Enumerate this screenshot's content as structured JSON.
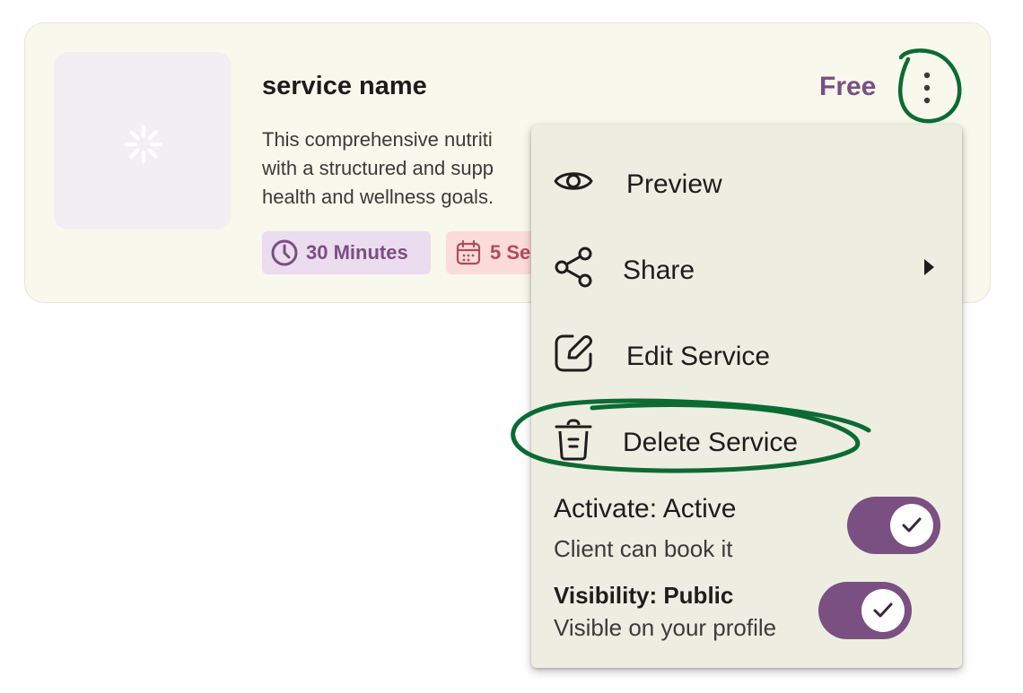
{
  "service": {
    "name": "service name",
    "price": "Free",
    "description_lines": [
      "This comprehensive nutriti",
      "with a structured and supp",
      "health and wellness goals."
    ],
    "duration": "30 Minutes",
    "sessions": "5 Se",
    "thumbnail_icon": "loader-icon",
    "more_icon": "more-vertical-icon"
  },
  "menu": {
    "preview": {
      "label": "Preview",
      "icon": "eye-icon"
    },
    "share": {
      "label": "Share",
      "icon": "share-icon"
    },
    "edit": {
      "label": "Edit Service",
      "icon": "edit-icon"
    },
    "delete": {
      "label": "Delete Service",
      "icon": "trash-icon"
    },
    "activate": {
      "title": "Activate: Active",
      "subtitle": "Client can book it",
      "on": true
    },
    "visibility": {
      "title": "Visibility: Public",
      "subtitle": "Visible on your profile",
      "on": true
    }
  },
  "colors": {
    "accent": "#7a4f82",
    "card_bg": "#f9f8ec",
    "menu_bg": "#eeede1",
    "annotation": "#0b6b33"
  }
}
